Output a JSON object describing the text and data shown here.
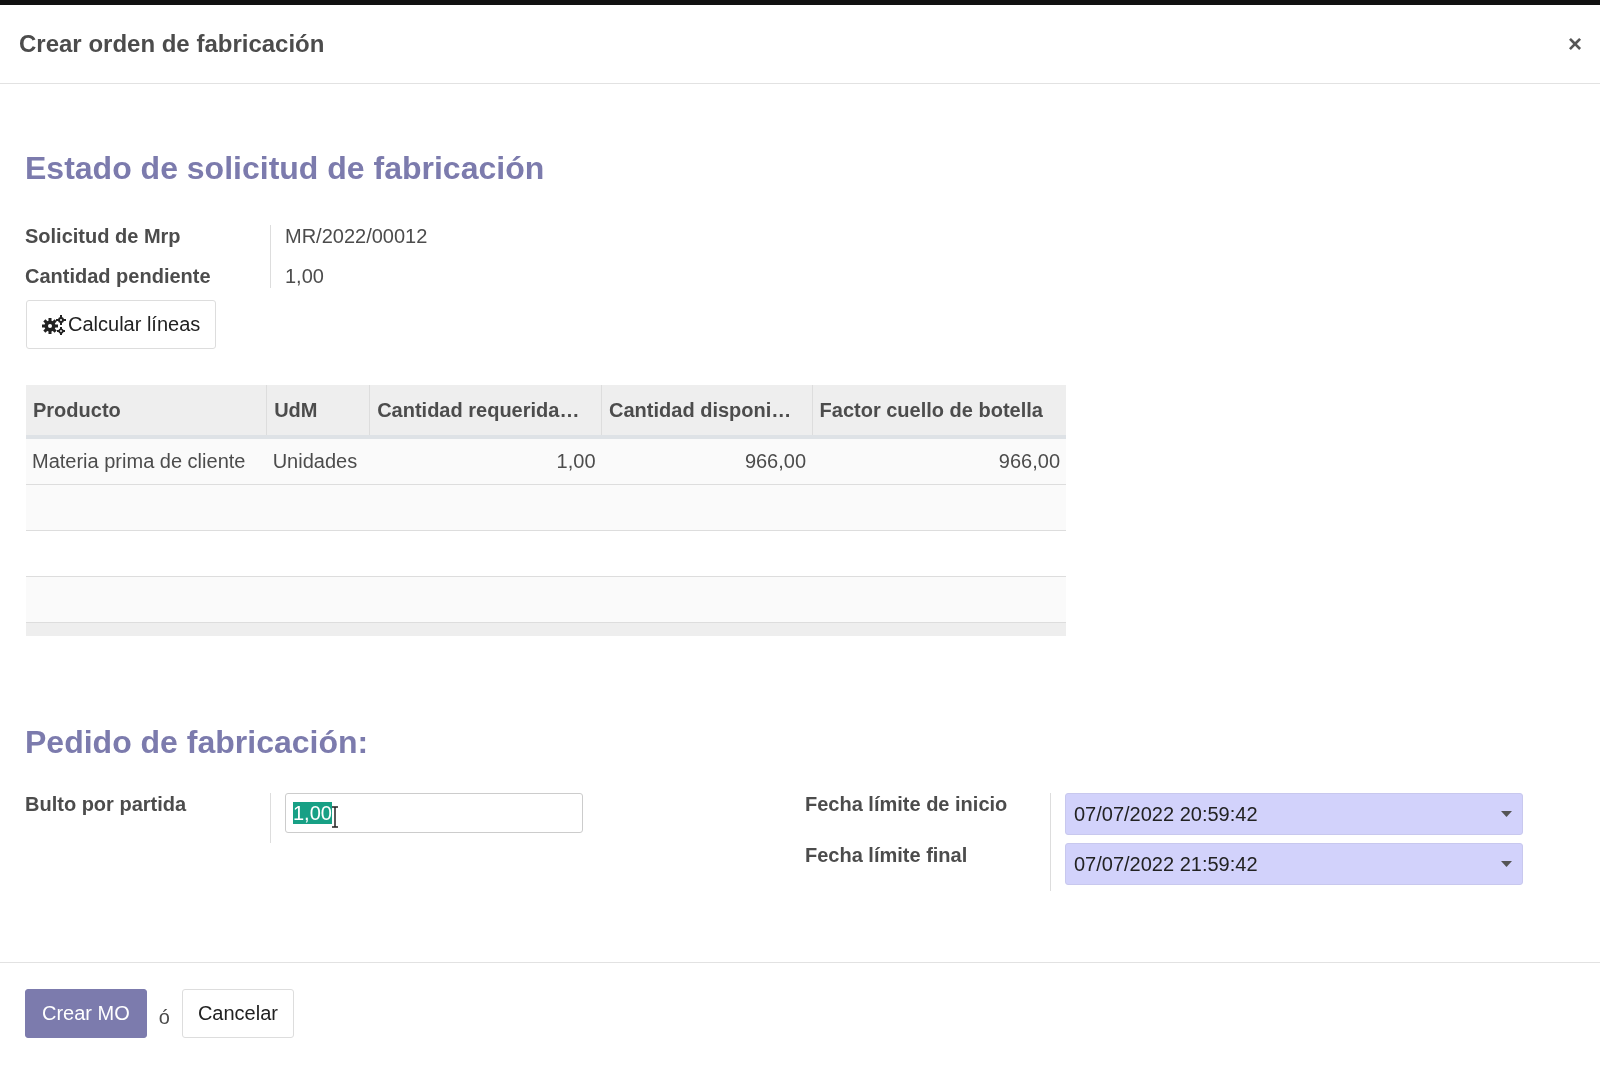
{
  "dialog": {
    "title": "Crear orden de fabricación",
    "close": "×"
  },
  "request_section": {
    "heading": "Estado de solicitud de fabricación",
    "fields": [
      {
        "label": "Solicitud de Mrp",
        "value": "MR/2022/00012"
      },
      {
        "label": "Cantidad pendiente",
        "value": "1,00"
      }
    ],
    "compute_button": "Calcular líneas",
    "table": {
      "columns": [
        {
          "label": "Producto",
          "numeric": false
        },
        {
          "label": "UdM",
          "numeric": false
        },
        {
          "label": "Cantidad requerida…",
          "numeric": true
        },
        {
          "label": "Cantidad disponi…",
          "numeric": true
        },
        {
          "label": "Factor cuello de botella",
          "numeric": true
        }
      ],
      "rows": [
        [
          "Materia prima de cliente",
          "Unidades",
          "1,00",
          "966,00",
          "966,00"
        ]
      ]
    }
  },
  "order_section": {
    "heading": "Pedido de fabricación:",
    "quantity": {
      "label": "Bulto por partida",
      "value": "1,00",
      "text_selected": true
    },
    "dates": [
      {
        "label": "Fecha límite de inicio",
        "value": "07/07/2022 20:59:42"
      },
      {
        "label": "Fecha límite final",
        "value": "07/07/2022 21:59:42"
      }
    ]
  },
  "footer": {
    "primary_button": "Crear MO",
    "separator": "ó",
    "cancel_button": "Cancelar"
  }
}
